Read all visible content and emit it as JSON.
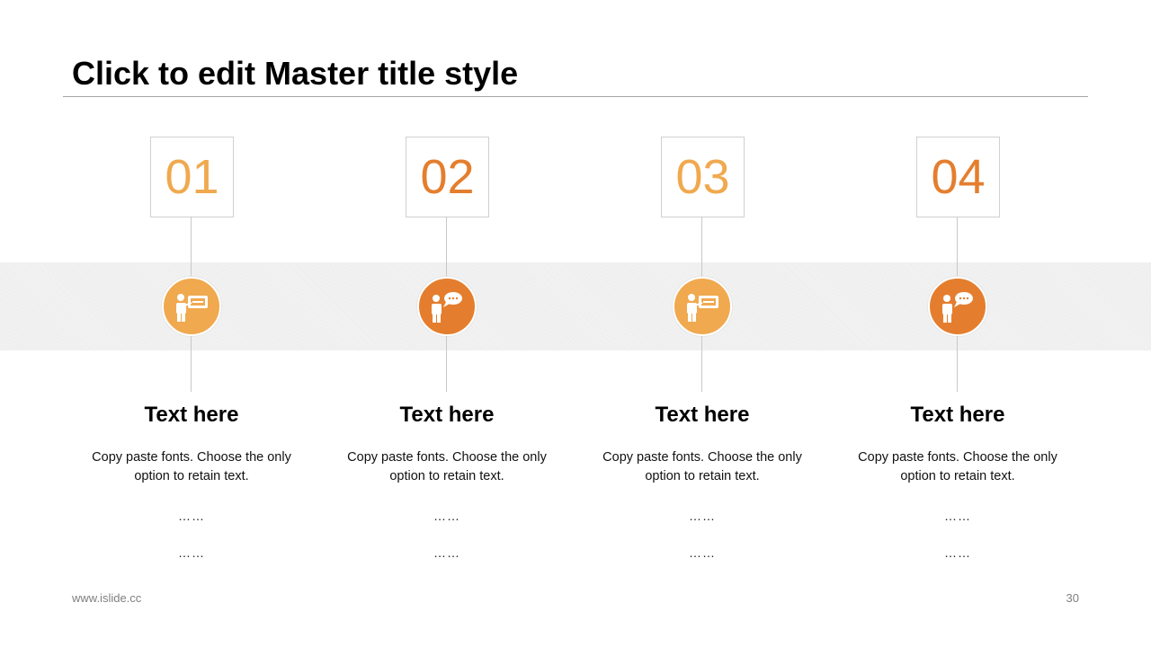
{
  "slide": {
    "title": "Click to edit Master title style",
    "footer_url": "www.islide.cc",
    "page_number": "30"
  },
  "colors": {
    "light_orange": "#F0A94F",
    "dark_orange": "#E47E2E",
    "band": "#F2F2F2",
    "rule": "#A6A6A6"
  },
  "columns": [
    {
      "number": "01",
      "icon": "presenter-board-icon",
      "heading": "Text here",
      "body": "Copy paste fonts. Choose the only option to retain text.",
      "dots1": "……",
      "dots2": "……"
    },
    {
      "number": "02",
      "icon": "presenter-speech-icon",
      "heading": "Text here",
      "body": "Copy paste fonts. Choose the only option to retain text.",
      "dots1": "……",
      "dots2": "……"
    },
    {
      "number": "03",
      "icon": "presenter-board-icon",
      "heading": "Text here",
      "body": "Copy paste fonts. Choose the only option to retain text.",
      "dots1": "……",
      "dots2": "……"
    },
    {
      "number": "04",
      "icon": "presenter-speech-icon",
      "heading": "Text here",
      "body": "Copy paste fonts. Choose the only option to retain text.",
      "dots1": "……",
      "dots2": "……"
    }
  ]
}
